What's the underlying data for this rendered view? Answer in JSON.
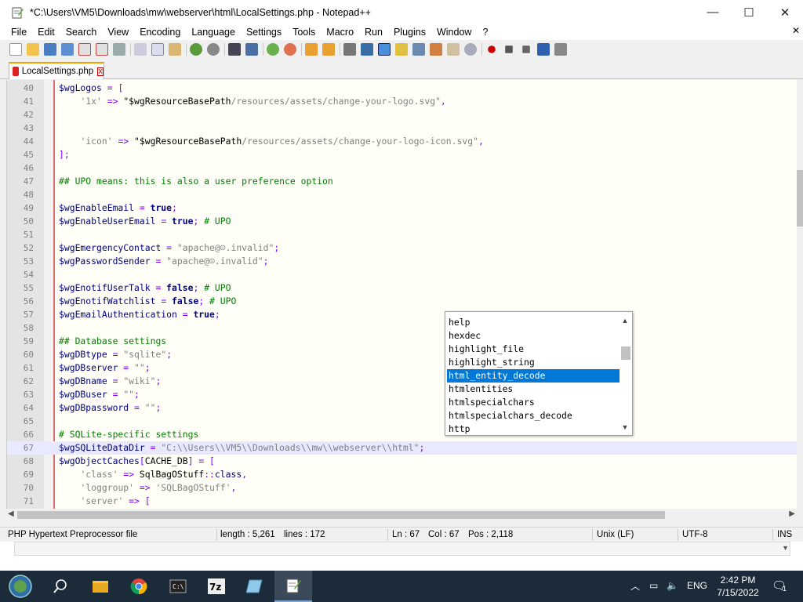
{
  "window": {
    "title": "*C:\\Users\\VM5\\Downloads\\mw\\webserver\\html\\LocalSettings.php - Notepad++",
    "minimize_glyph": "—",
    "maximize_glyph": "☐",
    "close_glyph": "✕"
  },
  "menu": {
    "items": [
      "File",
      "Edit",
      "Search",
      "View",
      "Encoding",
      "Language",
      "Settings",
      "Tools",
      "Macro",
      "Run",
      "Plugins",
      "Window",
      "?"
    ],
    "close_glyph": "✕"
  },
  "tab": {
    "label": "LocalSettings.php",
    "close_glyph": "x"
  },
  "editor": {
    "current_line": 67,
    "lines": [
      {
        "n": "40",
        "html": "<span class='var'>$wgLogos</span> <span class='op'>=</span> <span class='op'>[</span>"
      },
      {
        "n": "41",
        "html": "    <span class='str'>'1x'</span> <span class='op'>=&gt;</span> <span class='plain'>\"$wgResourceBasePath</span><span class='str'>/resources/assets/change-your-logo.svg\"</span><span class='op'>,</span>"
      },
      {
        "n": "42",
        "html": ""
      },
      {
        "n": "43",
        "html": ""
      },
      {
        "n": "44",
        "html": "    <span class='str'>'icon'</span> <span class='op'>=&gt;</span> <span class='plain'>\"$wgResourceBasePath</span><span class='str'>/resources/assets/change-your-logo-icon.svg\"</span><span class='op'>,</span>"
      },
      {
        "n": "45",
        "html": "<span class='op'>];</span>"
      },
      {
        "n": "46",
        "html": ""
      },
      {
        "n": "47",
        "html": "<span class='cmt'>## UPO means: this is also a user preference option</span>"
      },
      {
        "n": "48",
        "html": ""
      },
      {
        "n": "49",
        "html": "<span class='var'>$wgEnableEmail</span> <span class='op'>=</span> <span class='kw'>true</span><span class='op'>;</span>"
      },
      {
        "n": "50",
        "html": "<span class='var'>$wgEnableUserEmail</span> <span class='op'>=</span> <span class='kw'>true</span><span class='op'>;</span> <span class='cmt'># UPO</span>"
      },
      {
        "n": "51",
        "html": ""
      },
      {
        "n": "52",
        "html": "<span class='var'>$wgEmergencyContact</span> <span class='op'>=</span> <span class='str'>\"apache@☺.invalid\"</span><span class='op'>;</span>"
      },
      {
        "n": "53",
        "html": "<span class='var'>$wgPasswordSender</span> <span class='op'>=</span> <span class='str'>\"apache@☺.invalid\"</span><span class='op'>;</span>"
      },
      {
        "n": "54",
        "html": ""
      },
      {
        "n": "55",
        "html": "<span class='var'>$wgEnotifUserTalk</span> <span class='op'>=</span> <span class='kw'>false</span><span class='op'>;</span> <span class='cmt'># UPO</span>"
      },
      {
        "n": "56",
        "html": "<span class='var'>$wgEnotifWatchlist</span> <span class='op'>=</span> <span class='kw'>false</span><span class='op'>;</span> <span class='cmt'># UPO</span>"
      },
      {
        "n": "57",
        "html": "<span class='var'>$wgEmailAuthentication</span> <span class='op'>=</span> <span class='kw'>true</span><span class='op'>;</span>"
      },
      {
        "n": "58",
        "html": ""
      },
      {
        "n": "59",
        "html": "<span class='cmt'>## Database settings</span>"
      },
      {
        "n": "60",
        "html": "<span class='var'>$wgDBtype</span> <span class='op'>=</span> <span class='str'>\"sqlite\"</span><span class='op'>;</span>"
      },
      {
        "n": "61",
        "html": "<span class='var'>$wgDBserver</span> <span class='op'>=</span> <span class='str'>\"\"</span><span class='op'>;</span>"
      },
      {
        "n": "62",
        "html": "<span class='var'>$wgDBname</span> <span class='op'>=</span> <span class='str'>\"wiki\"</span><span class='op'>;</span>"
      },
      {
        "n": "63",
        "html": "<span class='var'>$wgDBuser</span> <span class='op'>=</span> <span class='str'>\"\"</span><span class='op'>;</span>"
      },
      {
        "n": "64",
        "html": "<span class='var'>$wgDBpassword</span> <span class='op'>=</span> <span class='str'>\"\"</span><span class='op'>;</span>"
      },
      {
        "n": "65",
        "html": ""
      },
      {
        "n": "66",
        "html": "<span class='cmt'># SQLite-specific settings</span>"
      },
      {
        "n": "67",
        "html": "<span class='var'>$wgSQLiteDataDir</span> <span class='op'>=</span> <span class='str'>\"C:\\\\Users\\\\VM5\\\\Downloads\\\\mw\\\\webserver\\\\html\"</span><span class='op'>;</span>"
      },
      {
        "n": "68",
        "html": "<span class='var'>$wgObjectCaches</span><span class='op'>[</span><span class='plain'>CACHE_DB</span><span class='op'>]</span> <span class='op'>=</span> <span class='op'>[</span>"
      },
      {
        "n": "69",
        "html": "    <span class='str'>'class'</span> <span class='op'>=&gt;</span> <span class='plain'>SqlBagOStuff</span><span class='op'>::</span><span class='kw' style='font-weight:normal'>class</span><span class='op'>,</span>"
      },
      {
        "n": "70",
        "html": "    <span class='str'>'loggroup'</span> <span class='op'>=&gt;</span> <span class='str'>'SQLBagOStuff'</span><span class='op'>,</span>"
      },
      {
        "n": "71",
        "html": "    <span class='str'>'server'</span> <span class='op'>=&gt;</span> <span class='op'>[</span>"
      }
    ]
  },
  "autocomplete": {
    "items": [
      "help",
      "hexdec",
      "highlight_file",
      "highlight_string",
      "html_entity_decode",
      "htmlentities",
      "htmlspecialchars",
      "htmlspecialchars_decode",
      "http"
    ],
    "selected_index": 4
  },
  "status": {
    "filetype": "PHP Hypertext Preprocessor file",
    "length": "length : 5,261",
    "lines": "lines : 172",
    "ln": "Ln : 67",
    "col": "Col : 67",
    "pos": "Pos : 2,118",
    "eol": "Unix (LF)",
    "encoding": "UTF-8",
    "mode": "INS"
  },
  "taskbar": {
    "language": "ENG",
    "time": "2:42 PM",
    "date": "7/15/2022",
    "notification_count": "1"
  },
  "colors": {
    "selection": "#0078d7",
    "current_line": "#e8e8ff",
    "variable": "#000080",
    "comment": "#008000",
    "string": "#808080",
    "operator": "#8000ff"
  }
}
